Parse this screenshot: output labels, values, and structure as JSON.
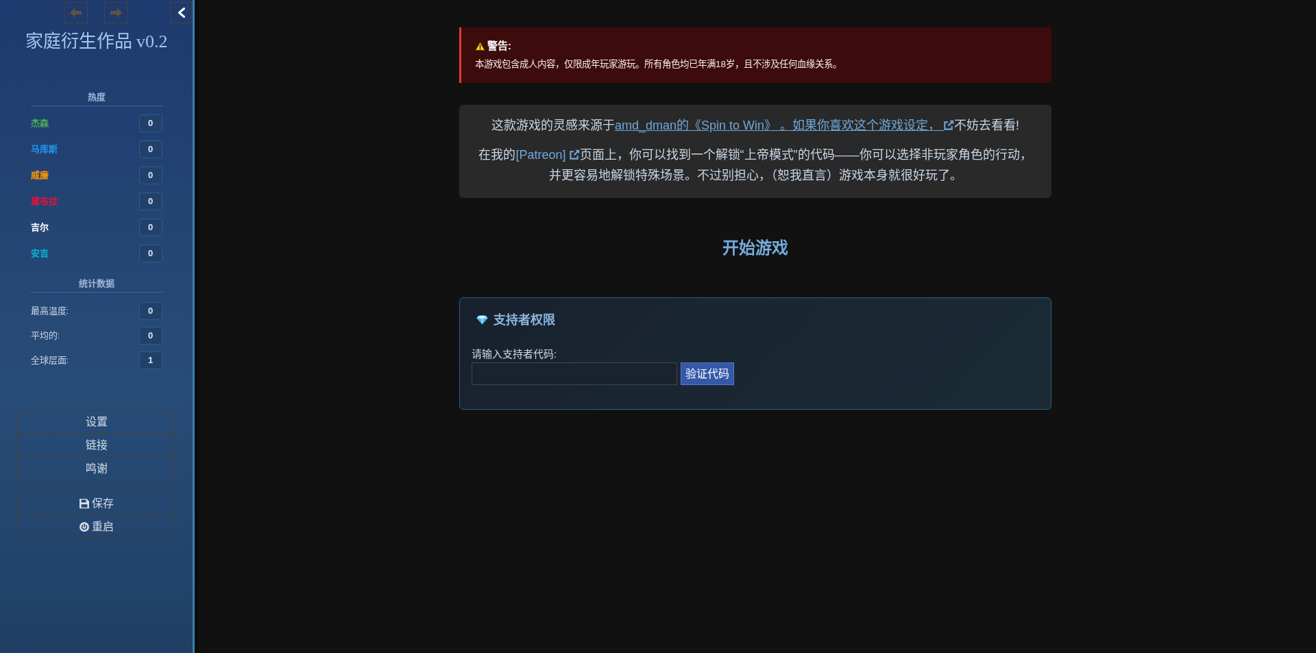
{
  "sidebar": {
    "history_buttons": [
      {
        "kind": "back",
        "disabled": true
      },
      {
        "kind": "forward",
        "disabled": true
      }
    ],
    "title": "家庭衍生作品 v0.2",
    "heat": {
      "heading": "热度",
      "characters": [
        {
          "name": "杰森",
          "value": "0",
          "color": "#4caf50"
        },
        {
          "name": "马库斯",
          "value": "0",
          "color": "#2196f3"
        },
        {
          "name": "威廉",
          "value": "0",
          "color": "#ff9800"
        },
        {
          "name": "黛布拉",
          "value": "0",
          "color": "#e8103c"
        },
        {
          "name": "吉尔",
          "value": "0",
          "color": "#ffffff"
        },
        {
          "name": "安吉",
          "value": "0",
          "color": "#00bcd4"
        }
      ]
    },
    "stats": {
      "heading": "统计数据",
      "rows": [
        {
          "label": "最高温度:",
          "value": "0"
        },
        {
          "label": "平均的:",
          "value": "0"
        },
        {
          "label": "全球层面:",
          "value": "1"
        }
      ]
    },
    "menu": [
      "设置",
      "链接",
      "鸣谢"
    ],
    "actions": [
      {
        "label": "保存",
        "kind": "save"
      },
      {
        "label": "重启",
        "kind": "restart"
      }
    ]
  },
  "main": {
    "warning": {
      "title": "警告:",
      "text": "本游戏包含成人内容，仅限成年玩家游玩。所有角色均已年满18岁，且不涉及任何血缘关系。"
    },
    "inspiration": [
      {
        "before": "这款游戏的灵感来源于",
        "link": "amd_dman的《Spin to Win》 。如果你喜欢这个游戏设定， ",
        "after": "不妨去看看!"
      },
      {
        "before": "在我的",
        "link": "[Patreon] ",
        "after": "页面上，你可以找到一个解锁“上帝模式”的代码——你可以选择非玩家角色的行动，并更容易地解锁特殊场景。不过别担心，（恕我直言）游戏本身就很好玩了。"
      }
    ],
    "start_game": "开始游戏",
    "supporter": {
      "title": "支持者权限",
      "label": "请输入支持者代码:",
      "button": "验证代码"
    }
  }
}
